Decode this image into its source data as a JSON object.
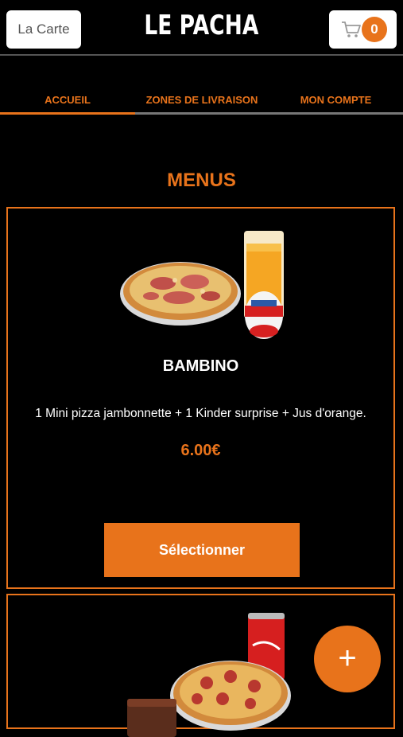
{
  "header": {
    "left_button": "La Carte",
    "logo": "LE PACHA",
    "cart_count": "0"
  },
  "tabs": [
    {
      "label": "ACCUEIL",
      "active": true
    },
    {
      "label": "ZONES DE LIVRAISON",
      "active": false
    },
    {
      "label": "MON COMPTE",
      "active": false
    }
  ],
  "section": {
    "title": "MENUS"
  },
  "menus": [
    {
      "name": "BAMBINO",
      "description": "1 Mini pizza jambonnette + 1 Kinder surprise + Jus d'orange.",
      "price": "6.00€",
      "button": "Sélectionner",
      "image_icons": [
        "pizza-icon",
        "orange-juice-glass-icon",
        "kinder-egg-icon"
      ]
    },
    {
      "image_icons": [
        "pizza-icon",
        "cola-can-icon",
        "brownie-icon"
      ]
    }
  ],
  "fab": {
    "label": "+"
  },
  "colors": {
    "accent": "#e8731b",
    "background": "#000000"
  }
}
